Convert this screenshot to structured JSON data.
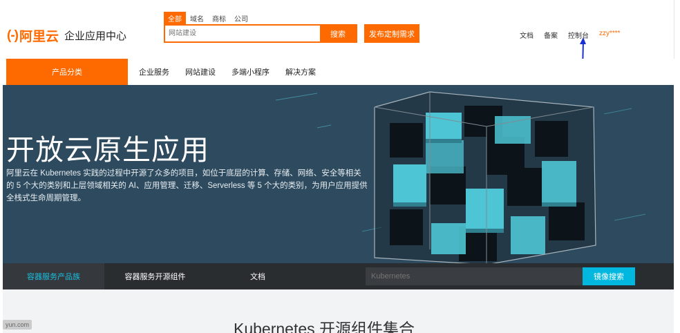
{
  "header": {
    "logo_mark": "(-)",
    "logo_text": "阿里云",
    "logo_sub": "企业应用中心",
    "search_tabs": [
      "全部",
      "域名",
      "商标",
      "公司"
    ],
    "search_placeholder": "网站建设",
    "search_button": "搜索",
    "publish_button": "发布定制需求",
    "links": [
      "文档",
      "备案",
      "控制台"
    ],
    "user": "zzy****",
    "accent_color": "#ff6a00"
  },
  "nav": {
    "category": "产品分类",
    "items": [
      "企业服务",
      "网站建设",
      "多端小程序",
      "解决方案"
    ]
  },
  "hero": {
    "title": "开放云原生应用",
    "description": "阿里云在 Kubernetes 实践的过程中开源了众多的项目，如位于底层的计算、存储、网络、安全等相关的 5 个大的类别和上层领域相关的 AI、应用管理、迁移、Serverless 等 5 个大的类别，为用户应用提供全栈式生命周期管理。",
    "background_color": "#2d4a5e"
  },
  "subnav": {
    "tabs": [
      "容器服务产品族",
      "容器服务开源组件",
      "文档"
    ],
    "search_placeholder": "Kubernetes",
    "search_button": "镜像搜索"
  },
  "bottom": {
    "title": "Kubernetes 开源组件集合",
    "badge": "yun.com"
  }
}
